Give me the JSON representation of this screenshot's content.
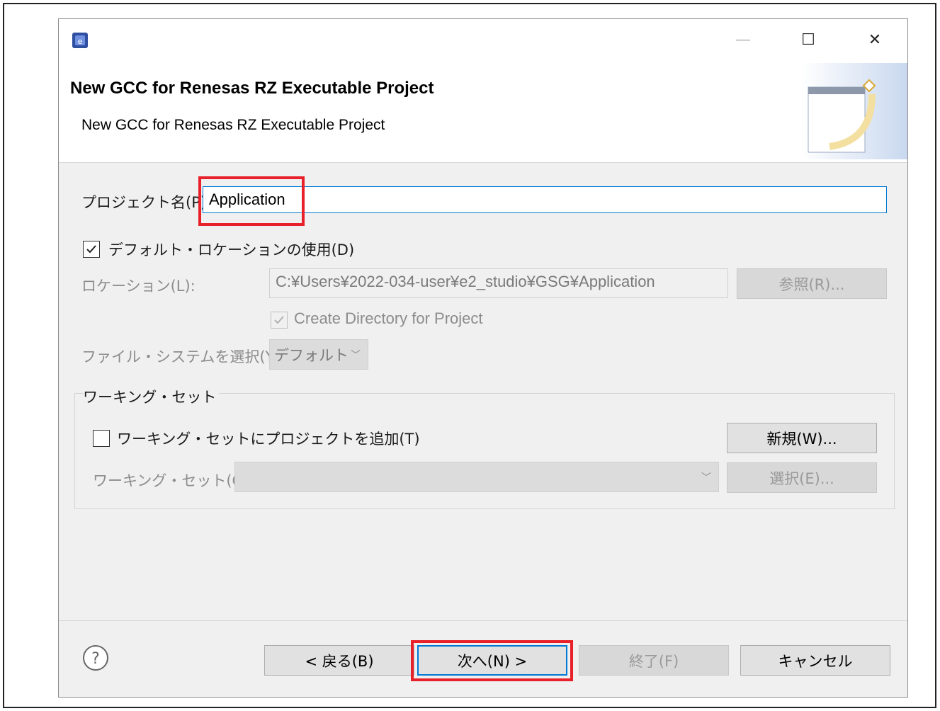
{
  "header": {
    "title": "New GCC for Renesas RZ Executable Project",
    "description": "New GCC for Renesas RZ Executable Project"
  },
  "window_controls": {
    "minimize": "—",
    "maximize": "☐",
    "close": "✕"
  },
  "form": {
    "project_name_label": "プロジェクト名(P):",
    "project_name_value": "Application",
    "use_default_location_label": "デフォルト・ロケーションの使用(D)",
    "use_default_location_checked": true,
    "location_label": "ロケーション(L):",
    "location_value": "C:¥Users¥2022-034-user¥e2_studio¥GSG¥Application",
    "browse_button": "参照(R)...",
    "create_directory_label": "Create Directory for Project",
    "filesystem_label": "ファイル・システムを選択(Y):",
    "filesystem_value": "デフォルト"
  },
  "working_set": {
    "group_label": "ワーキング・セット",
    "add_checkbox_label": "ワーキング・セットにプロジェクトを追加(T)",
    "add_checked": false,
    "new_button": "新規(W)...",
    "select_label": "ワーキング・セット(O):",
    "select_value": "",
    "select_button": "選択(E)..."
  },
  "footer": {
    "back_button": "< 戻る(B)",
    "next_button": "次へ(N) >",
    "finish_button": "終了(F)",
    "cancel_button": "キャンセル"
  },
  "colors": {
    "highlight": "#e8202a",
    "focus_border": "#0078d4"
  }
}
